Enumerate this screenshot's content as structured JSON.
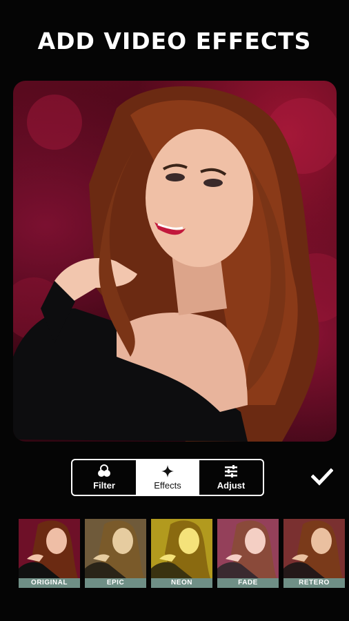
{
  "headline": "ADD VIDEO EFFECTS",
  "tabs": [
    {
      "label": "Filter",
      "icon": "filter-icon",
      "active": false
    },
    {
      "label": "Effects",
      "icon": "sparkle-icon",
      "active": true
    },
    {
      "label": "Adjust",
      "icon": "sliders-icon",
      "active": false
    }
  ],
  "confirm_icon": "checkmark-icon",
  "effects": [
    {
      "label": "ORIGINAL",
      "tint": "#7a1530"
    },
    {
      "label": "EPIC",
      "tint": "#8a6a40"
    },
    {
      "label": "NEON",
      "tint": "#c9b42a"
    },
    {
      "label": "FADE",
      "tint": "#a0465a"
    },
    {
      "label": "RETERO",
      "tint": "#8a3a3a"
    }
  ]
}
